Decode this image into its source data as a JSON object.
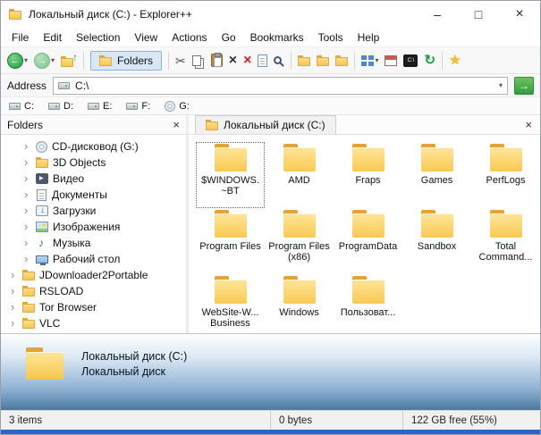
{
  "window": {
    "title": "Локальный диск (C:) - Explorer++",
    "controls": {
      "minimize": "–",
      "maximize": "□",
      "close": "×"
    }
  },
  "menu_bar": {
    "items": [
      "File",
      "Edit",
      "Selection",
      "View",
      "Actions",
      "Go",
      "Bookmarks",
      "Tools",
      "Help"
    ]
  },
  "toolbar": {
    "folders_button_label": "Folders",
    "icons": [
      "back",
      "forward",
      "up",
      "folders",
      "cut",
      "copy",
      "paste",
      "delete",
      "delete-permanently",
      "properties",
      "search",
      "new-folder",
      "copy-to-folder",
      "move-to-folder",
      "views",
      "new-tab",
      "command-prompt",
      "refresh",
      "add-bookmark"
    ]
  },
  "address_bar": {
    "label": "Address",
    "value": "C:\\"
  },
  "drive_bar": {
    "drives": [
      "C:",
      "D:",
      "E:",
      "F:",
      "G:"
    ]
  },
  "folders_panel": {
    "title": "Folders",
    "tree": [
      {
        "label": "CD-дисковод (G:)",
        "icon": "disc"
      },
      {
        "label": "3D Objects",
        "icon": "folder"
      },
      {
        "label": "Видео",
        "icon": "video"
      },
      {
        "label": "Документы",
        "icon": "documents"
      },
      {
        "label": "Загрузки",
        "icon": "downloads"
      },
      {
        "label": "Изображения",
        "icon": "pictures"
      },
      {
        "label": "Музыка",
        "icon": "music"
      },
      {
        "label": "Рабочий стол",
        "icon": "desktop"
      },
      {
        "label": "JDownloader2Portable",
        "icon": "folder"
      },
      {
        "label": "RSLOAD",
        "icon": "folder"
      },
      {
        "label": "Tor Browser",
        "icon": "folder"
      },
      {
        "label": "VLC",
        "icon": "folder"
      }
    ]
  },
  "tab_bar": {
    "active_tab": "Локальный диск (C:)"
  },
  "file_list": [
    {
      "name": "$WINDOWS.~BT",
      "selected": true
    },
    {
      "name": "AMD",
      "selected": false
    },
    {
      "name": "Fraps",
      "selected": false
    },
    {
      "name": "Games",
      "selected": false
    },
    {
      "name": "PerfLogs",
      "selected": false
    },
    {
      "name": "Program Files",
      "selected": false
    },
    {
      "name": "Program Files (x86)",
      "selected": false
    },
    {
      "name": "ProgramData",
      "selected": false
    },
    {
      "name": "Sandbox",
      "selected": false
    },
    {
      "name": "Total Command...",
      "selected": false
    },
    {
      "name": "WebSite-W... Business",
      "selected": false
    },
    {
      "name": "Windows",
      "selected": false
    },
    {
      "name": "Пользоват...",
      "selected": false
    }
  ],
  "info_panel": {
    "title": "Локальный диск (C:)",
    "subtitle": "Локальный диск"
  },
  "status_bar": {
    "items_count": "3 items",
    "selection_size": "0 bytes",
    "free_space": "122 GB free (55%)"
  }
}
